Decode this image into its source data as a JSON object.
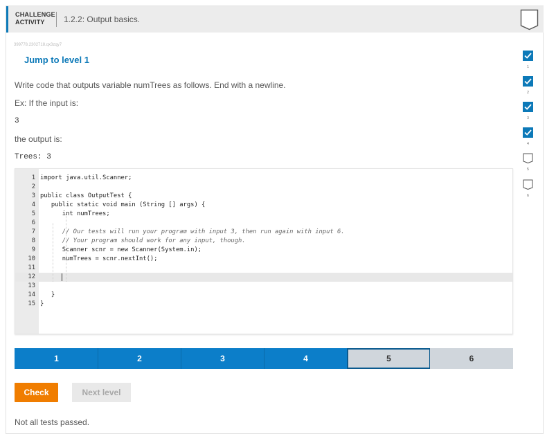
{
  "header": {
    "label_line1": "CHALLENGE",
    "label_line2": "ACTIVITY",
    "title": "1.2.2: Output basics."
  },
  "activity_id": "399778.2302718.qx3zqy7",
  "jump_link": "Jump to level 1",
  "instructions": "Write code that outputs variable numTrees as follows. End with a newline.",
  "example_label": "Ex: If the input is:",
  "example_input": "3",
  "output_label": "the output is:",
  "example_output": "Trees: 3",
  "editor": {
    "line_numbers": [
      "1",
      "2",
      "3",
      "4",
      "5",
      "6",
      "7",
      "8",
      "9",
      "10",
      "11",
      "12",
      "13",
      "14",
      "15"
    ],
    "lines": [
      "import java.util.Scanner;",
      "",
      "public class OutputTest {",
      "   public static void main (String [] args) {",
      "      int numTrees;",
      "",
      "      // Our tests will run your program with input 3, then run again with input 6.",
      "      // Your program should work for any input, though.",
      "      Scanner scnr = new Scanner(System.in);",
      "      numTrees = scnr.nextInt();",
      "",
      "      ",
      "",
      "   }",
      "}"
    ]
  },
  "progress": {
    "segments": [
      "1",
      "2",
      "3",
      "4",
      "5",
      "6"
    ],
    "current": 5
  },
  "buttons": {
    "check": "Check",
    "next": "Next level"
  },
  "status": "Not all tests passed.",
  "levels": [
    {
      "num": "1",
      "completed": true
    },
    {
      "num": "2",
      "completed": true
    },
    {
      "num": "3",
      "completed": true
    },
    {
      "num": "4",
      "completed": true
    },
    {
      "num": "5",
      "completed": false
    },
    {
      "num": "6",
      "completed": false
    }
  ],
  "colors": {
    "accent": "#0c79b8",
    "progress_done": "#0c7ec9",
    "check_button": "#f07d00"
  }
}
